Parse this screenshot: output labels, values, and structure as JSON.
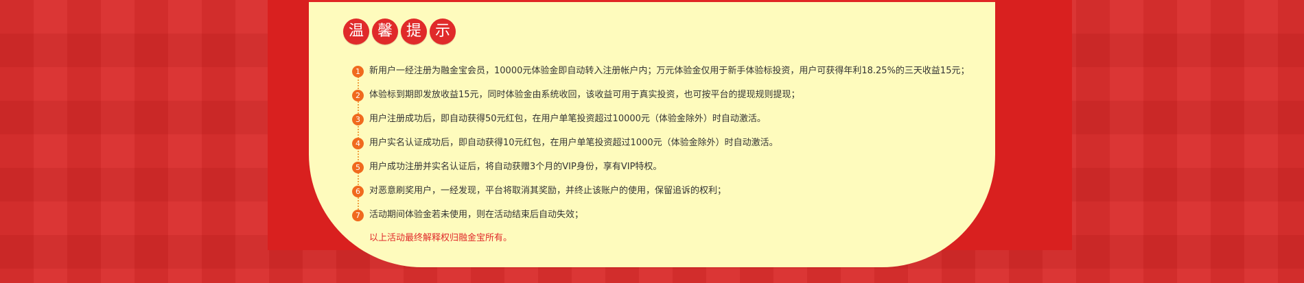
{
  "title_chars": [
    "温",
    "馨",
    "提",
    "示"
  ],
  "items": [
    {
      "num": "1",
      "text": "新用户一经注册为融金宝会员，10000元体验金即自动转入注册帐户内；万元体验金仅用于新手体验标投资，用户可获得年利18.25%的三天收益15元；"
    },
    {
      "num": "2",
      "text": "体验标到期即发放收益15元，同时体验金由系统收回，该收益可用于真实投资，也可按平台的提现规则提现；"
    },
    {
      "num": "3",
      "text": "用户注册成功后，即自动获得50元红包，在用户单笔投资超过10000元（体验金除外）时自动激活。"
    },
    {
      "num": "4",
      "text": "用户实名认证成功后，即自动获得10元红包，在用户单笔投资超过1000元（体验金除外）时自动激活。"
    },
    {
      "num": "5",
      "text": "用户成功注册并实名认证后，将自动获赠3个月的VIP身份，享有VIP特权。"
    },
    {
      "num": "6",
      "text": "对恶意刷奖用户，一经发现，平台将取消其奖励，并终止该账户的使用，保留追诉的权利；"
    },
    {
      "num": "7",
      "text": "活动期间体验金若未使用，则在活动结束后自动失效；"
    }
  ],
  "footer_note": "以上活动最终解释权归融金宝所有。",
  "colors": {
    "background_red": "#d92a29",
    "card_yellow": "#fefbbd",
    "accent_red": "#e02a2a",
    "number_orange": "#f06a1e"
  }
}
